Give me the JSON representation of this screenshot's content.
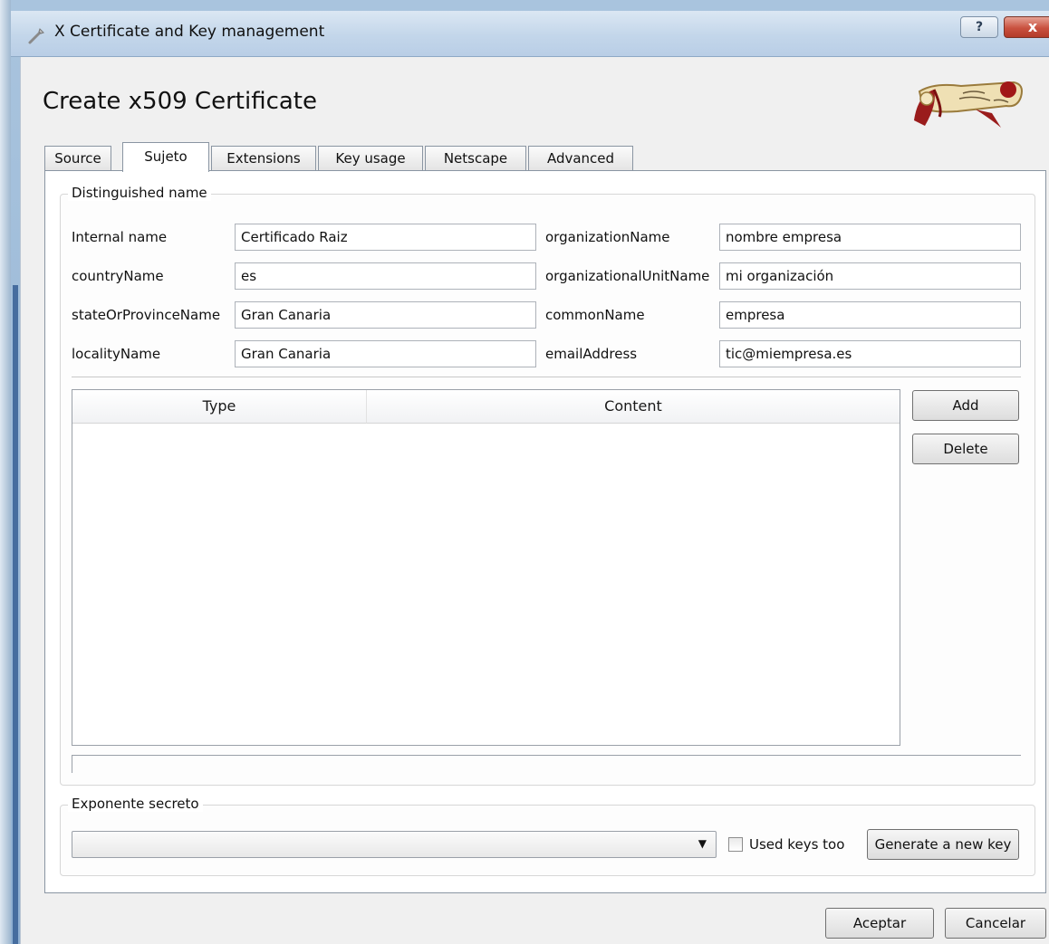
{
  "window": {
    "title": "X Certificate and Key management",
    "help_button": "?",
    "close_button": "x"
  },
  "dialog": {
    "heading": "Create x509 Certificate"
  },
  "tabs": [
    {
      "label": "Source"
    },
    {
      "label": "Sujeto"
    },
    {
      "label": "Extensions"
    },
    {
      "label": "Key usage"
    },
    {
      "label": "Netscape"
    },
    {
      "label": "Advanced"
    }
  ],
  "active_tab": "Sujeto",
  "distinguished_name": {
    "group_title": "Distinguished name",
    "fields": [
      {
        "label": "Internal name",
        "value": "Certificado Raiz"
      },
      {
        "label": "countryName",
        "value": "es"
      },
      {
        "label": "stateOrProvinceName",
        "value": "Gran Canaria"
      },
      {
        "label": "localityName",
        "value": "Gran Canaria"
      },
      {
        "label": "organizationName",
        "value": "nombre empresa"
      },
      {
        "label": "organizationalUnitName",
        "value": "mi organización"
      },
      {
        "label": "commonName",
        "value": "empresa"
      },
      {
        "label": "emailAddress",
        "value": "tic@miempresa.es"
      }
    ],
    "table": {
      "columns": [
        "Type",
        "Content"
      ],
      "rows": []
    },
    "add_button": "Add",
    "delete_button": "Delete"
  },
  "secret_exponent": {
    "group_title": "Exponente secreto",
    "selected": "",
    "used_keys_label": "Used keys too",
    "used_keys_checked": false,
    "generate_button": "Generate a new key"
  },
  "footer": {
    "ok_button": "Aceptar",
    "cancel_button": "Cancelar"
  },
  "colors": {
    "titlebar": "#c3d6ea",
    "close_button": "#c9513f",
    "dialog_background": "#f0f0f0"
  }
}
